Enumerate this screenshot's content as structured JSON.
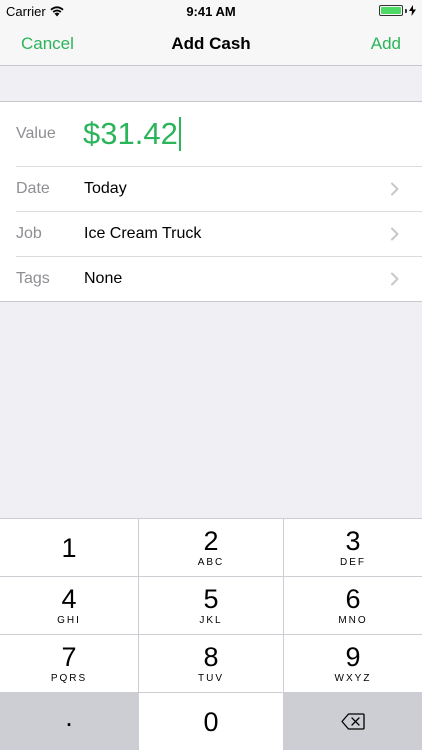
{
  "status_bar": {
    "carrier": "Carrier",
    "time": "9:41 AM",
    "wifi_icon": "wifi-icon",
    "battery_icon": "battery-icon",
    "charging_icon": "charging-bolt-icon"
  },
  "nav": {
    "cancel_label": "Cancel",
    "title": "Add Cash",
    "add_label": "Add"
  },
  "form": {
    "value_label": "Value",
    "value_amount": "$31.42",
    "date_label": "Date",
    "date_value": "Today",
    "job_label": "Job",
    "job_value": "Ice Cream Truck",
    "tags_label": "Tags",
    "tags_value": "None"
  },
  "keypad": {
    "keys": [
      {
        "digit": "1",
        "letters": ""
      },
      {
        "digit": "2",
        "letters": "ABC"
      },
      {
        "digit": "3",
        "letters": "DEF"
      },
      {
        "digit": "4",
        "letters": "GHI"
      },
      {
        "digit": "5",
        "letters": "JKL"
      },
      {
        "digit": "6",
        "letters": "MNO"
      },
      {
        "digit": "7",
        "letters": "PQRS"
      },
      {
        "digit": "8",
        "letters": "TUV"
      },
      {
        "digit": "9",
        "letters": "WXYZ"
      }
    ],
    "decimal": ".",
    "zero": "0",
    "delete_icon": "backspace-icon"
  },
  "colors": {
    "accent": "#2cb45b",
    "background": "#efeff4",
    "label_gray": "#8e8e93"
  }
}
